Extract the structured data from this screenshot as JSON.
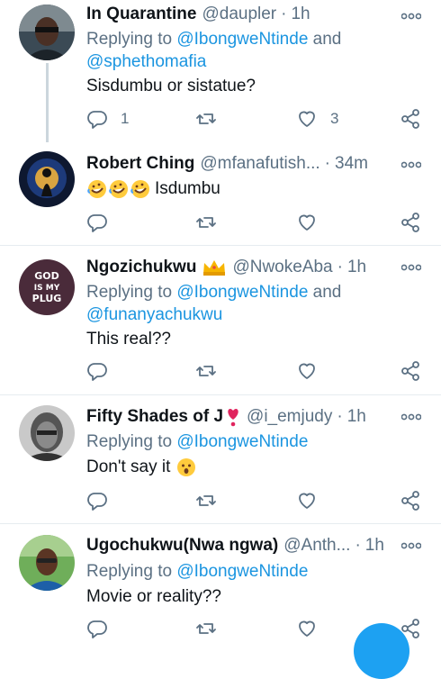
{
  "tweets": [
    {
      "name": "In Quarantine",
      "handle": "@daupler",
      "time": "1h",
      "reply_prefix": "Replying to ",
      "reply_mention1": "@IbongweNtinde",
      "reply_and": " and ",
      "reply_mention2": "@sphethomafia",
      "text": "Sisdumbu or sistatue?",
      "reply_count": "1",
      "like_count": "3"
    },
    {
      "name": "Robert Ching",
      "handle": "@mfanafutish...",
      "time": "34m",
      "text": "Isdumbu"
    },
    {
      "name": "Ngozichukwu",
      "handle": "@NwokeAba",
      "time": "1h",
      "reply_prefix": "Replying to ",
      "reply_mention1": "@IbongweNtinde",
      "reply_and": " and ",
      "reply_mention2": "@funanyachukwu",
      "text": "This real??",
      "avatar_text": [
        "GOD",
        "IS MY",
        "PLUG"
      ]
    },
    {
      "name": "Fifty Shades of J",
      "handle": "@i_emjudy",
      "time": "1h",
      "reply_prefix": "Replying to ",
      "reply_mention1": "@IbongweNtinde",
      "text": "Don't say it"
    },
    {
      "name": "Ugochukwu(Nwa ngwa)",
      "handle": "@Anth...",
      "time": "1h",
      "reply_prefix": "Replying to ",
      "reply_mention1": "@IbongweNtinde",
      "text": "Movie or reality??"
    }
  ],
  "dot": "·",
  "icons": {
    "reply": "reply-icon",
    "retweet": "retweet-icon",
    "like": "like-icon",
    "share": "share-icon",
    "more": "more-icon",
    "compose": "compose-fab"
  },
  "colors": {
    "accent": "#1b95e0",
    "muted": "#5b7083",
    "text": "#0f1419",
    "divider": "#e6ecf0"
  }
}
